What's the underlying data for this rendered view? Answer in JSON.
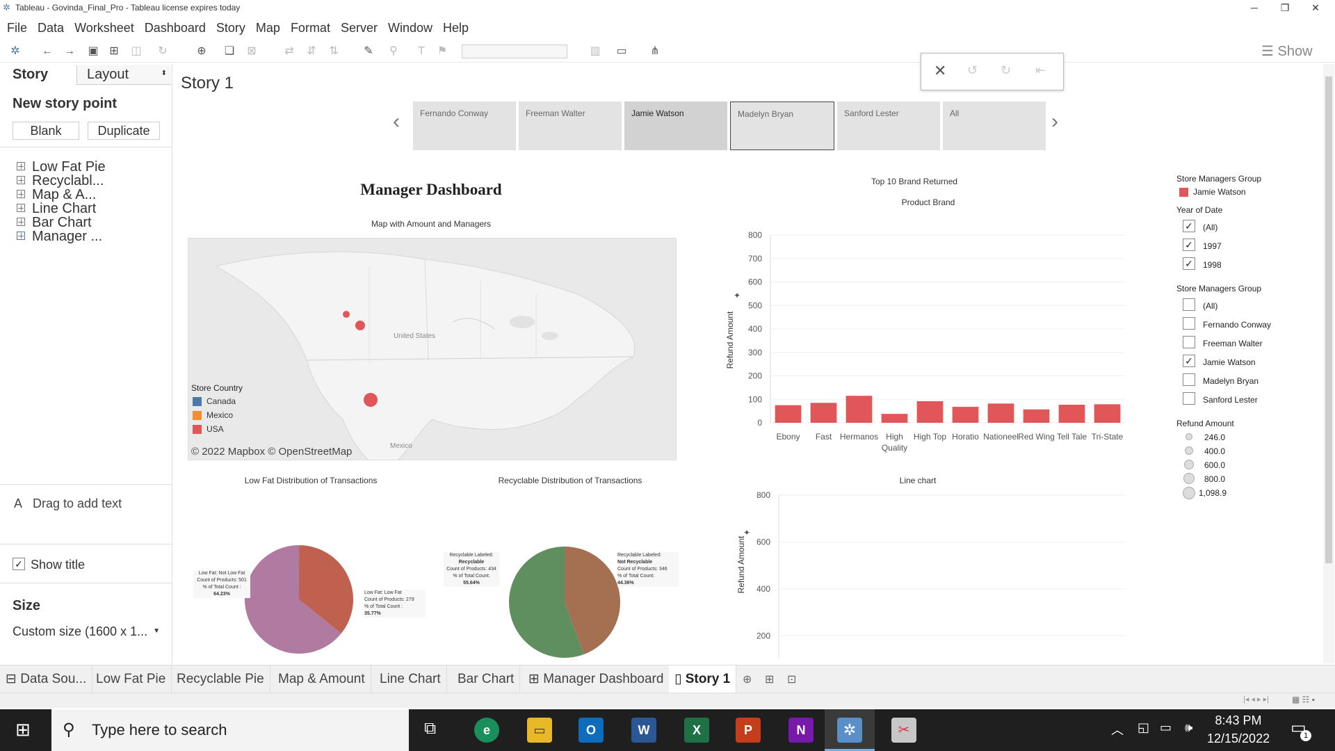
{
  "window": {
    "title": "Tableau - Govinda_Final_Pro - Tableau license expires today"
  },
  "menu": [
    "File",
    "Data",
    "Worksheet",
    "Dashboard",
    "Story",
    "Map",
    "Format",
    "Server",
    "Window",
    "Help"
  ],
  "toolbar": {
    "show_label": "Show"
  },
  "left_panel": {
    "tab_story": "Story",
    "tab_layout": "Layout",
    "new_story_point": "New story point",
    "blank_label": "Blank",
    "duplicate_label": "Duplicate",
    "sheets": [
      "Low Fat Pie",
      "Recyclabl...",
      "Map & A...",
      "Line Chart",
      "Bar Chart",
      "Manager ..."
    ],
    "drag_text": "Drag to add text",
    "show_title": "Show title",
    "size_label": "Size",
    "size_value": "Custom size (1600 x 1..."
  },
  "story": {
    "title": "Story 1",
    "points": [
      "Fernando Conway",
      "Freeman Walter",
      "Jamie Watson",
      "Madelyn Bryan",
      "Sanford Lester",
      "All"
    ]
  },
  "dashboard": {
    "title": "Manager Dashboard",
    "map_title": "Map with Amount and Managers",
    "map_attribution": "© 2022 Mapbox © OpenStreetMap",
    "map_labels": {
      "us": "United States",
      "mx": "Mexico"
    },
    "store_country_title": "Store Country",
    "store_countries": [
      {
        "name": "Canada",
        "color": "#4e79a7"
      },
      {
        "name": "Mexico",
        "color": "#f28e2b"
      },
      {
        "name": "USA",
        "color": "#e15759"
      }
    ],
    "low_fat_title": "Low Fat Distribution of Transactions",
    "recyclable_title": "Recyclable Distribution of Transactions",
    "line_title": "Line chart",
    "bar_title": "Top 10 Brand Returned",
    "bar_subtitle": "Product Brand"
  },
  "tooltips": {
    "lowfat_notlow": [
      "Low Fat: Not Low Fat",
      "Count of Products: 501",
      "% of Total Count :",
      "64.23%"
    ],
    "lowfat_low": [
      "Low Fat: Low Fat",
      "Count of Products: 279",
      "% of Total Count :",
      "35.77%"
    ],
    "recycl_yes": [
      "Recyclable Labeled:",
      "Recyclable",
      "Count of Products: 434",
      "% of Total Count:",
      "55.64%"
    ],
    "recycl_no": [
      "Recyclable Labeled:",
      "Not Recyclable",
      "Count of Products: 346",
      "% of Total Count:",
      "44.36%"
    ]
  },
  "filters": {
    "group1_title": "Store Managers Group",
    "group1_value": "Jamie Watson",
    "year_title": "Year of Date",
    "years": [
      {
        "label": "(All)",
        "checked": true
      },
      {
        "label": "1997",
        "checked": true
      },
      {
        "label": "1998",
        "checked": true
      }
    ],
    "group2_title": "Store Managers Group",
    "managers": [
      {
        "label": "(All)",
        "checked": false
      },
      {
        "label": "Fernando Conway",
        "checked": false
      },
      {
        "label": "Freeman Walter",
        "checked": false
      },
      {
        "label": "Jamie Watson",
        "checked": true
      },
      {
        "label": "Madelyn Bryan",
        "checked": false
      },
      {
        "label": "Sanford Lester",
        "checked": false
      }
    ],
    "refund_title": "Refund Amount",
    "refund_sizes": [
      "246.0",
      "400.0",
      "600.0",
      "800.0",
      "1,098.9"
    ]
  },
  "sheet_tabs": [
    "Data Sou...",
    "Low Fat Pie",
    "Recyclable Pie",
    "Map & Amount",
    "Line Chart",
    "Bar Chart",
    "Manager Dashboard",
    "Story 1"
  ],
  "taskbar": {
    "search_placeholder": "Type here to search",
    "time": "8:43 PM",
    "date": "12/15/2022",
    "notif_count": "1"
  },
  "chart_data": [
    {
      "type": "bar",
      "title": "Top 10 Brand Returned",
      "subtitle": "Product Brand",
      "ylabel": "Refund Amount",
      "categories": [
        "Ebony",
        "Fast",
        "Hermanos",
        "High Quality",
        "High Top",
        "Horatio",
        "Nationeel",
        "Red Wing",
        "Tell Tale",
        "Tri-State"
      ],
      "values": [
        75,
        85,
        115,
        38,
        92,
        68,
        82,
        57,
        77,
        79
      ],
      "ylim": [
        0,
        800
      ],
      "yticks": [
        0,
        100,
        200,
        300,
        400,
        500,
        600,
        700,
        800
      ],
      "color": "#e15759"
    },
    {
      "type": "pie",
      "title": "Low Fat Distribution of Transactions",
      "labels": [
        "Not Low Fat",
        "Low Fat"
      ],
      "values": [
        501,
        279
      ],
      "percents": [
        64.23,
        35.77
      ],
      "colors": [
        "#b07aa1",
        "#c0604e"
      ]
    },
    {
      "type": "pie",
      "title": "Recyclable Distribution of Transactions",
      "labels": [
        "Recyclable",
        "Not Recyclable"
      ],
      "values": [
        434,
        346
      ],
      "percents": [
        55.64,
        44.36
      ],
      "colors": [
        "#5f8f5f",
        "#a56f52"
      ]
    },
    {
      "type": "line",
      "title": "Line chart",
      "ylabel": "Refund Amount",
      "ylim": [
        100,
        800
      ],
      "yticks": [
        200,
        400,
        600,
        800
      ]
    }
  ]
}
